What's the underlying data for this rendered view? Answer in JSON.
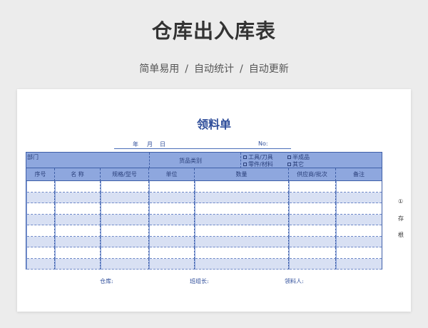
{
  "header": {
    "title": "仓库出入库表",
    "subtitle_parts": [
      "简单易用",
      "自动统计",
      "自动更新"
    ],
    "separator": "/"
  },
  "form": {
    "title": "领料单",
    "date": {
      "year": "年",
      "month": "月",
      "day": "日",
      "no": "No:"
    },
    "dept_label": "部门",
    "goods_label": "货品类别",
    "options": [
      "工具/刀具",
      "半成品",
      "零件/材料",
      "其它"
    ],
    "columns": [
      "序号",
      "名  称",
      "规格/型号",
      "单位",
      "数量",
      "供应商/批次",
      "备注"
    ],
    "row_count": 8,
    "footer": {
      "store": "仓库:",
      "leader": "班组长:",
      "receiver": "领料人:"
    },
    "side": [
      "①",
      "存",
      "根"
    ]
  },
  "colors": {
    "accent": "#2e4d9a",
    "header_fill": "#8ea7de",
    "row_alt": "#d8e0f3"
  }
}
